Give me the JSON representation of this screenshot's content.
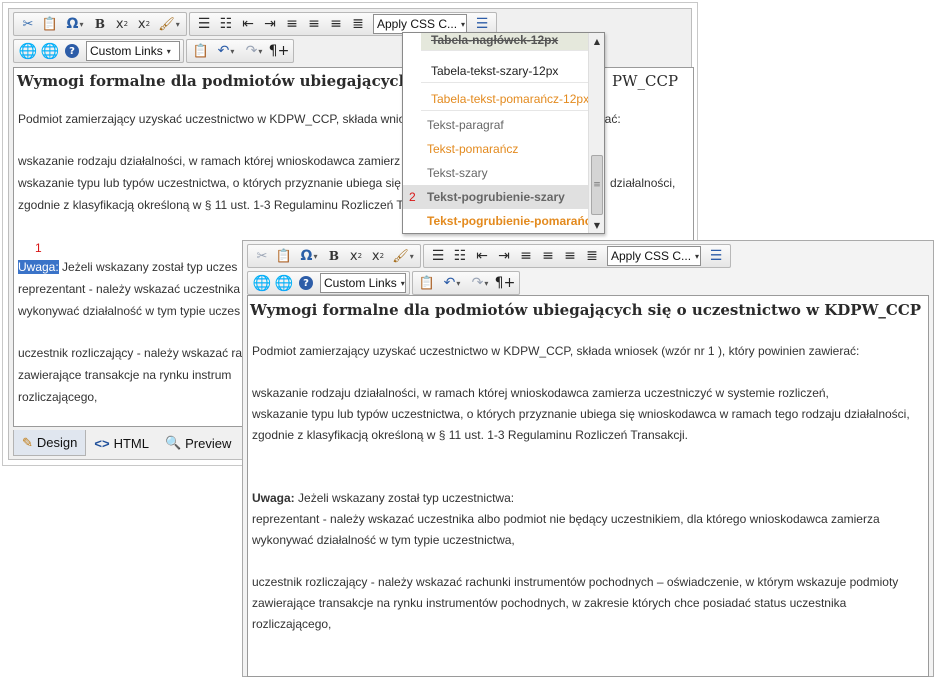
{
  "toolbar": {
    "icons": {
      "cut": "✂",
      "paste": "📋",
      "omega": "Ω",
      "bold": "B",
      "subscript_base": "x",
      "subscript_mark": "2",
      "superscript_base": "x",
      "superscript_mark": "2",
      "brush": "🖌",
      "list_bullet": "☰",
      "list_number": "☷",
      "outdent": "⇤",
      "indent": "⇥",
      "align_left": "≡",
      "align_center": "≡",
      "align_right": "≡",
      "align_justify": "≣",
      "format": "☰",
      "link": "🌐",
      "unlink": "🌐",
      "help": "?",
      "undo": "↶",
      "redo": "↷",
      "paragraph": "¶+"
    },
    "css_class_select": "Apply CSS C...",
    "custom_links_select": "Custom Links",
    "dropdown_arrow": "▾"
  },
  "back_editor": {
    "title": "Wymogi formalne dla podmiotów ubiegających",
    "title_tail": "PW_CCP",
    "paragraphs": [
      "Podmiot zamierzający uzyskać uczestnictwo w KDPW_CCP, składa wnio",
      "wskazanie rodzaju działalności, w ramach której wnioskodawca zamierz",
      "wskazanie typu lub typów uczestnictwa, o których przyznanie ubiega się w",
      "zgodnie z klasyfikacją określoną w § 11 ust. 1-3 Regulaminu Rozliczeń T",
      "reprezentant - należy wskazać uczestnika",
      "wykonywać działalność w tym typie uczes",
      "uczestnik rozliczający - należy wskazać ra",
      "zawierające transakcje na rynku instrum",
      "rozliczającego,"
    ],
    "tails": {
      "p0": "erać:",
      "p2": "działalności,"
    },
    "uwaga_label": "Uwaga:",
    "uwaga_rest": " Jeżeli wskazany został typ uczes",
    "marker_1": "1",
    "tabs": {
      "design": "Design",
      "html": "HTML",
      "preview": "Preview"
    },
    "tab_icons": {
      "design": "✎",
      "html": "<>",
      "preview": "🔍"
    }
  },
  "css_dropdown": {
    "items": [
      "Tabela-nagłówek-12px",
      "Tabela-tekst-szary-12px",
      "Tabela-tekst-pomarańcz-12px",
      "Tekst-paragraf",
      "Tekst-pomarańcz",
      "Tekst-szary",
      "Tekst-pogrubienie-szary",
      "Tekst-pogrubienie-pomarańcz"
    ],
    "selected_marker": "2",
    "scroll_up": "▲",
    "scroll_down": "▼",
    "scroll_grip": "≡",
    "colors": {
      "orange": "#e38a1e",
      "header_bg": "#e5e8dc"
    }
  },
  "front_editor": {
    "title": "Wymogi formalne dla podmiotów ubiegających się o uczestnictwo w KDPW_CCP",
    "intro": "Podmiot zamierzający uzyskać uczestnictwo w KDPW_CCP, składa wniosek (wzór nr 1 ), który powinien zawierać:",
    "items": [
      "wskazanie rodzaju działalności, w ramach której wnioskodawca zamierza uczestniczyć w systemie rozliczeń,",
      "wskazanie typu lub typów uczestnictwa, o których przyznanie ubiega się wnioskodawca w ramach tego rodzaju działalności,",
      "zgodnie z klasyfikacją określoną w § 11 ust. 1-3 Regulaminu Rozliczeń Transakcji."
    ],
    "uwaga_label": "Uwaga:",
    "uwaga_rest": " Jeżeli wskazany został typ uczestnictwa:",
    "reprezentant": [
      "reprezentant - należy wskazać uczestnika albo podmiot nie będący uczestnikiem, dla którego wnioskodawca zamierza",
      "wykonywać działalność w tym typie uczestnictwa,"
    ],
    "uczestnik": [
      "uczestnik rozliczający - należy wskazać rachunki instrumentów pochodnych – oświadczenie, w którym wskazuje podmioty",
      "zawierające transakcje na rynku instrumentów pochodnych, w zakresie których chce posiadać status uczestnika",
      "rozliczającego,"
    ]
  }
}
